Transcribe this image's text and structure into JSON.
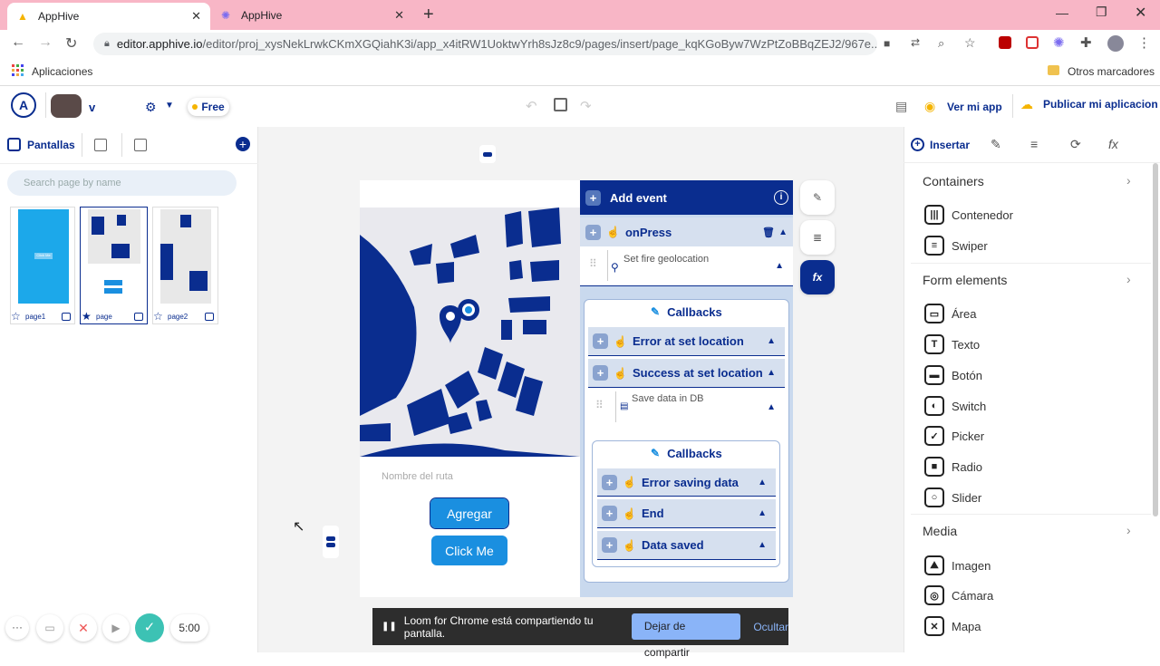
{
  "browser": {
    "tabs": [
      {
        "title": "AppHive",
        "active": true
      },
      {
        "title": "AppHive",
        "active": false
      }
    ],
    "url_host": "editor.apphive.io",
    "url_path": "/editor/proj_xysNekLrwkCKmXGQiahK3i/app_x4itRW1UoktwYrh8sJz8c9/pages/insert/page_kqKGoByw7WzPtZoBBqZEJ2/967e...",
    "bookmarks_apps": "Aplicaciones",
    "bookmarks_other": "Otros marcadores"
  },
  "topbar": {
    "user_initial": "v",
    "plan": "Free",
    "view_app": "Ver mi app",
    "publish": "Publicar mi aplicacion"
  },
  "left": {
    "screens_tab": "Pantallas",
    "search_placeholder": "Search page by name",
    "pages": [
      {
        "name": "page1",
        "mini_label": "Click Me"
      },
      {
        "name": "page"
      },
      {
        "name": "page2"
      }
    ]
  },
  "right": {
    "insert_tab": "Insertar",
    "sections": [
      {
        "title": "Containers",
        "items": [
          "Contenedor",
          "Swiper"
        ]
      },
      {
        "title": "Form elements",
        "items": [
          "Área",
          "Texto",
          "Botón",
          "Switch",
          "Picker",
          "Radio",
          "Slider"
        ]
      },
      {
        "title": "Media",
        "items": [
          "Imagen",
          "Cámara",
          "Mapa"
        ]
      }
    ]
  },
  "phone": {
    "route_placeholder": "Nombre del ruta",
    "button1": "Agregar",
    "button2": "Click Me"
  },
  "events": {
    "title": "Add event",
    "on_press": "onPress",
    "action1": "Set fire geolocation",
    "callbacks1": "Callbacks",
    "error_location": "Error at set location",
    "success_location": "Success at set location",
    "action2": "Save data in DB",
    "callbacks2": "Callbacks",
    "error_saving": "Error saving data",
    "end": "End",
    "data_saved": "Data saved"
  },
  "recorder": {
    "timer": "5:00"
  },
  "loom": {
    "message": "Loom for Chrome está compartiendo tu pantalla.",
    "stop": "Dejar de compartir",
    "hide": "Ocultar"
  },
  "colors": {
    "accent": "#0a2d8f",
    "brand_tab": "#f8b6c6",
    "button": "#1a8fe0"
  }
}
